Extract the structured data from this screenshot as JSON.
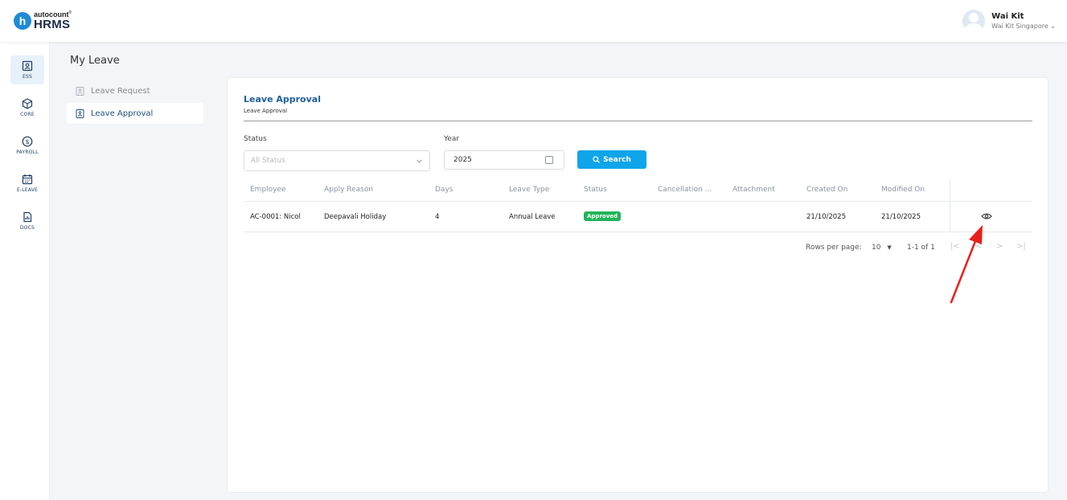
{
  "brand": {
    "top": "autocount",
    "top_mark": "®",
    "bottom": "HRMS",
    "badge": "h"
  },
  "user": {
    "name": "Wai Kit",
    "company": "Wai Kit Singapore",
    "caret": "⌄"
  },
  "rail": [
    {
      "label": "ESS",
      "icon": "ess-icon",
      "active": true
    },
    {
      "label": "CORE",
      "icon": "core-icon",
      "active": false
    },
    {
      "label": "PAYROLL",
      "icon": "payroll-icon",
      "active": false
    },
    {
      "label": "E-LEAVE",
      "icon": "e-leave-icon",
      "active": false
    },
    {
      "label": "DOCS",
      "icon": "docs-icon",
      "active": false
    }
  ],
  "subnav": {
    "title": "My Leave",
    "items": [
      {
        "label": "Leave Request",
        "icon": "document-icon",
        "active": false
      },
      {
        "label": "Leave Approval",
        "icon": "document-icon",
        "active": true
      }
    ]
  },
  "card": {
    "title": "Leave Approval",
    "subtitle": "Leave Approval"
  },
  "filters": {
    "status_label": "Status",
    "status_placeholder": "All Status",
    "year_label": "Year",
    "year_value": "2025",
    "search_label": "Search"
  },
  "table": {
    "headers": [
      "Employee",
      "Apply Reason",
      "Days",
      "Leave Type",
      "Status",
      "Cancellation ...",
      "Attachment",
      "Created On",
      "Modified On"
    ],
    "rows": [
      {
        "employee": "AC-0001: Nicol",
        "reason": "Deepavali Holiday",
        "days": "4",
        "leave_type": "Annual Leave",
        "status": "Approved",
        "cancellation": "",
        "attachment": "",
        "created_on": "21/10/2025",
        "modified_on": "21/10/2025"
      }
    ]
  },
  "pagination": {
    "rows_per_page_label": "Rows per page:",
    "rows_per_page": "10",
    "range": "1-1 of 1",
    "first": "|<",
    "prev": "<",
    "next": ">",
    "last": ">|"
  },
  "colors": {
    "accent": "#0ea5e9",
    "title": "#1f5f9a",
    "approved": "#21b35a",
    "annotation": "#e8201c"
  }
}
